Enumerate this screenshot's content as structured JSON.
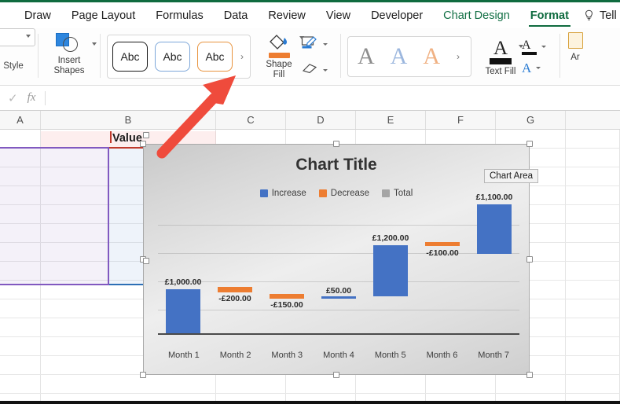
{
  "ribbon": {
    "tabs": [
      {
        "label": "Draw",
        "state": "normal"
      },
      {
        "label": "Page Layout",
        "state": "normal"
      },
      {
        "label": "Formulas",
        "state": "normal"
      },
      {
        "label": "Data",
        "state": "normal"
      },
      {
        "label": "Review",
        "state": "normal"
      },
      {
        "label": "View",
        "state": "normal"
      },
      {
        "label": "Developer",
        "state": "normal"
      },
      {
        "label": "Chart Design",
        "state": "contextual"
      },
      {
        "label": "Format",
        "state": "active"
      }
    ],
    "tell_me": "Tell me",
    "style_group_label": "Style",
    "insert_shapes_label": "Insert\nShapes",
    "shape_styles": [
      {
        "label": "Abc",
        "variant": "black"
      },
      {
        "label": "Abc",
        "variant": "blue"
      },
      {
        "label": "Abc",
        "variant": "orange"
      }
    ],
    "gallery_more": "›",
    "shape_fill_label": "Shape\nFill",
    "shape_fill_color": "#ed7d31",
    "wordart_styles": [
      {
        "label": "A",
        "variant": "gray"
      },
      {
        "label": "A",
        "variant": "blue"
      },
      {
        "label": "A",
        "variant": "orange"
      }
    ],
    "text_fill_label": "Text Fill",
    "arrange_label": "Ar"
  },
  "formula_bar": {
    "check_icon": "check-icon",
    "fx_icon": "fx",
    "value": ""
  },
  "sheet": {
    "column_headers": [
      "A",
      "B",
      "C",
      "D",
      "E",
      "F",
      "G"
    ],
    "value_header": "Value"
  },
  "chart": {
    "title": "Chart Title",
    "tooltip": "Chart Area",
    "legend": [
      {
        "label": "Increase",
        "color": "#4472c4"
      },
      {
        "label": "Decrease",
        "color": "#ed7d31"
      },
      {
        "label": "Total",
        "color": "#a5a5a5"
      }
    ]
  },
  "chart_data": {
    "type": "bar",
    "subtype": "waterfall",
    "title": "Chart Title",
    "xlabel": "",
    "ylabel": "",
    "categories": [
      "Month 1",
      "Month 2",
      "Month 3",
      "Month 4",
      "Month 5",
      "Month 6",
      "Month 7"
    ],
    "series": [
      {
        "name": "Value",
        "values": [
          1000,
          -200,
          -150,
          50,
          1200,
          -100,
          1100
        ],
        "labels": [
          "£1,000.00",
          "-£200.00",
          "-£150.00",
          "£50.00",
          "£1,200.00",
          "-£100.00",
          "£1,100.00"
        ],
        "types": [
          "increase",
          "decrease",
          "decrease",
          "increase",
          "increase",
          "decrease",
          "increase"
        ],
        "cumulative_start": [
          0,
          1000,
          800,
          650,
          700,
          1900,
          1800
        ],
        "cumulative_end": [
          1000,
          800,
          650,
          700,
          1900,
          1800,
          2900
        ]
      }
    ],
    "legend_entries": [
      "Increase",
      "Decrease",
      "Total"
    ],
    "legend_position": "top",
    "grid": true,
    "ylim": [
      0,
      3100
    ],
    "colors": {
      "increase": "#4472c4",
      "decrease": "#ed7d31",
      "total": "#a5a5a5"
    }
  },
  "annotation": {
    "arrow_color": "#ef4b3c",
    "name": "red-arrow-pointer"
  }
}
